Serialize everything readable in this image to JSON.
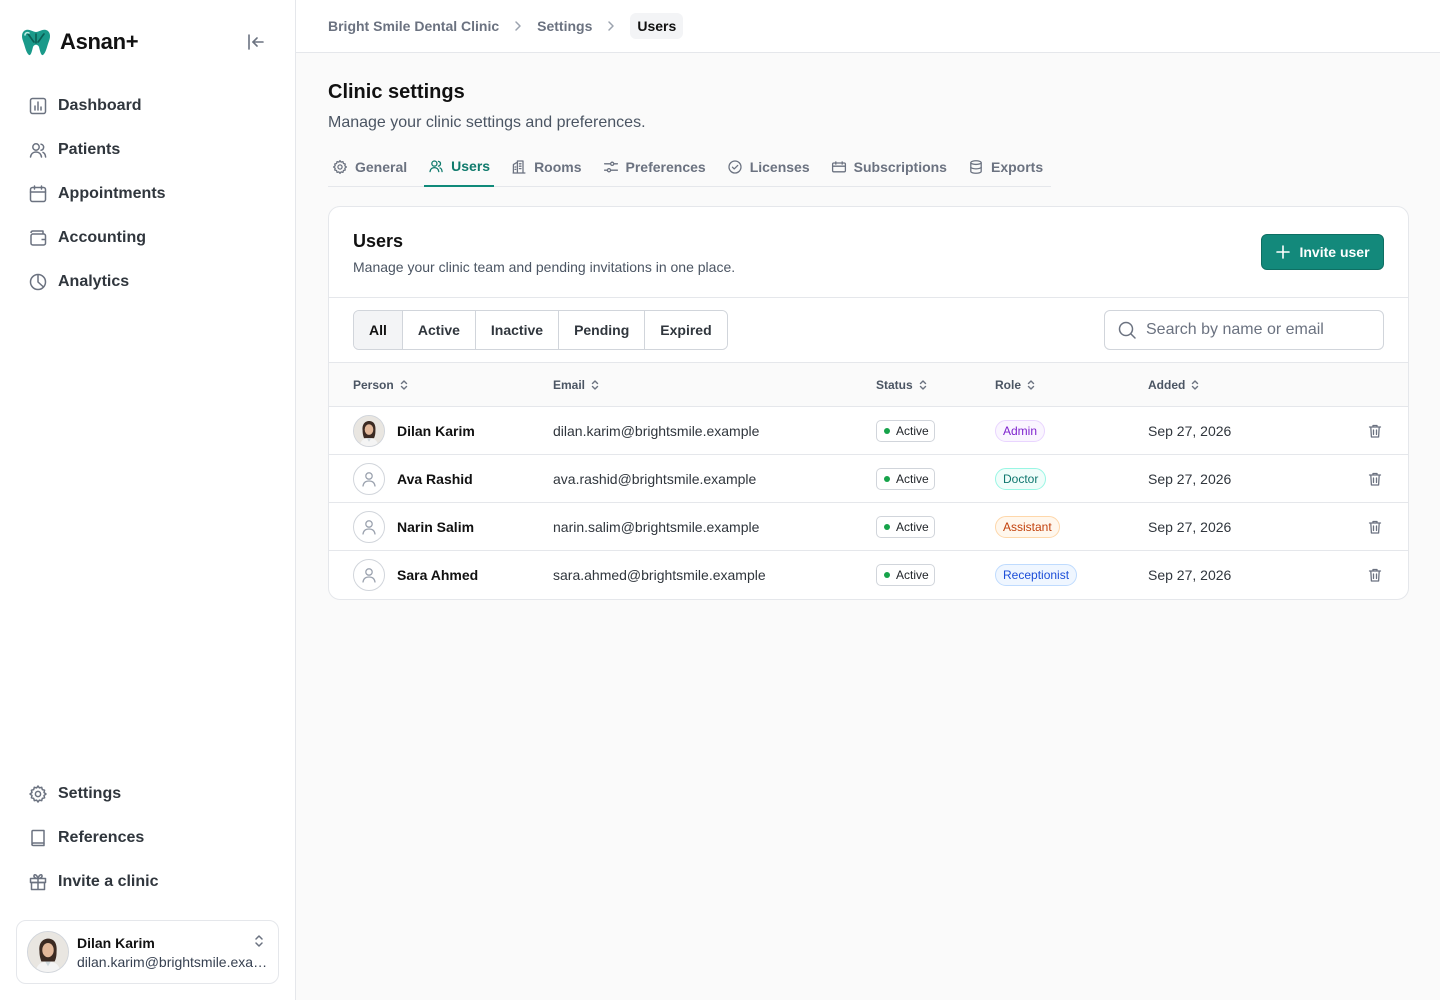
{
  "app": {
    "name": "Asnan+"
  },
  "sidebar": {
    "nav": [
      {
        "label": "Dashboard",
        "icon": "chart-icon"
      },
      {
        "label": "Patients",
        "icon": "users-icon"
      },
      {
        "label": "Appointments",
        "icon": "calendar-icon"
      },
      {
        "label": "Accounting",
        "icon": "wallet-icon"
      },
      {
        "label": "Analytics",
        "icon": "pie-chart-icon"
      }
    ],
    "bottom_nav": [
      {
        "label": "Settings",
        "icon": "gear-icon"
      },
      {
        "label": "References",
        "icon": "book-icon"
      },
      {
        "label": "Invite a clinic",
        "icon": "gift-icon"
      }
    ],
    "user": {
      "name": "Dilan Karim",
      "email": "dilan.karim@brightsmile.example"
    }
  },
  "breadcrumb": [
    "Bright Smile Dental Clinic",
    "Settings",
    "Users"
  ],
  "page": {
    "title": "Clinic settings",
    "subtitle": "Manage your clinic settings and preferences."
  },
  "tabs": [
    {
      "label": "General",
      "icon": "gear-icon",
      "active": false
    },
    {
      "label": "Users",
      "icon": "users-icon",
      "active": true
    },
    {
      "label": "Rooms",
      "icon": "building-icon",
      "active": false
    },
    {
      "label": "Preferences",
      "icon": "sliders-icon",
      "active": false
    },
    {
      "label": "Licenses",
      "icon": "badge-check-icon",
      "active": false
    },
    {
      "label": "Subscriptions",
      "icon": "ticket-icon",
      "active": false
    },
    {
      "label": "Exports",
      "icon": "database-icon",
      "active": false
    }
  ],
  "users_card": {
    "title": "Users",
    "subtitle": "Manage your clinic team and pending invitations in one place.",
    "invite_label": "Invite user",
    "filters": [
      "All",
      "Active",
      "Inactive",
      "Pending",
      "Expired"
    ],
    "active_filter": "All",
    "search_placeholder": "Search by name or email",
    "columns": [
      "Person",
      "Email",
      "Status",
      "Role",
      "Added"
    ],
    "rows": [
      {
        "name": "Dilan Karim",
        "email": "dilan.karim@brightsmile.example",
        "status": "Active",
        "role": "Admin",
        "added": "Sep 27, 2026",
        "avatar": "photo"
      },
      {
        "name": "Ava Rashid",
        "email": "ava.rashid@brightsmile.example",
        "status": "Active",
        "role": "Doctor",
        "added": "Sep 27, 2026",
        "avatar": "placeholder"
      },
      {
        "name": "Narin Salim",
        "email": "narin.salim@brightsmile.example",
        "status": "Active",
        "role": "Assistant",
        "added": "Sep 27, 2026",
        "avatar": "placeholder"
      },
      {
        "name": "Sara Ahmed",
        "email": "sara.ahmed@brightsmile.example",
        "status": "Active",
        "role": "Receptionist",
        "added": "Sep 27, 2026",
        "avatar": "placeholder"
      }
    ]
  },
  "colors": {
    "brand": "#13897b",
    "status_active": "#16a34a",
    "role_admin": "#7e22ce",
    "role_doctor": "#0f766e",
    "role_assistant": "#c2410c",
    "role_receptionist": "#1d4ed8"
  }
}
